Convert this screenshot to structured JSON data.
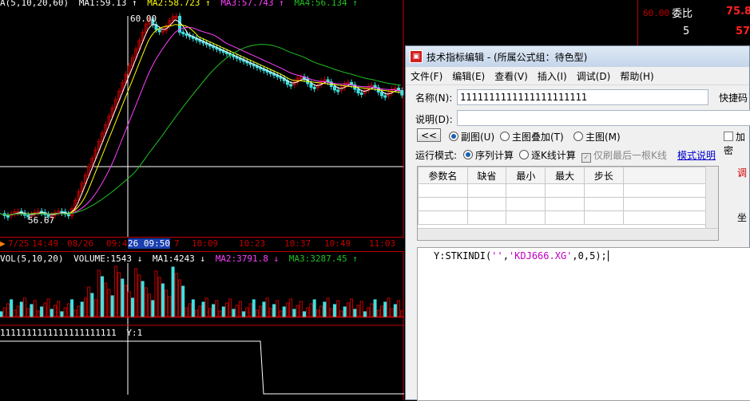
{
  "colors": {
    "up": "#c00000",
    "down": "#40e0e0",
    "ma1": "#ffffff",
    "ma2": "#ffff00",
    "ma3": "#ff40ff",
    "ma4": "#20c020",
    "axis": "#c00000"
  },
  "price_panel": {
    "legend": [
      "A(5,10,20,60)",
      "MA1:59.13 ↑",
      "MA2:58.723 ↑",
      "MA3:57.743 ↑",
      "MA4:56.134 ↑"
    ],
    "high_label": "60.00",
    "low_label": "56.67"
  },
  "time_axis": {
    "labels": [
      "7/25",
      "14:49",
      "08/26",
      "09:4",
      "26 09:50",
      "7",
      "10:09",
      "10:23",
      "10:37",
      "10:49",
      "11:03"
    ]
  },
  "volume_panel": {
    "legend": [
      "VOL(5,10,20)",
      "VOLUME:1543 ↓",
      "MA1:4243 ↓",
      "MA2:3791.8 ↓",
      "MA3:3287.45 ↑"
    ]
  },
  "indicator_panel": {
    "legend": [
      "1111111111111111111111",
      "Y:1"
    ]
  },
  "right_panel": {
    "price_label": "60.00",
    "weibi_label": "委比",
    "weibi_value": "75.8",
    "row_num": "5",
    "row_val": "57"
  },
  "dialog": {
    "title": "技术指标编辑 - (所属公式组：待色型)",
    "menu": [
      "文件(F)",
      "编辑(E)",
      "查看(V)",
      "插入(I)",
      "调试(D)",
      "帮助(H)"
    ],
    "name_label": "名称(N):",
    "name_value": "1111111111111111111111",
    "shortcut_label": "快捷码",
    "desc_label": "说明(D):",
    "desc_value": "",
    "back_button": "<<",
    "radio_sub": "副图(U)",
    "radio_overlay": "主图叠加(T)",
    "radio_main": "主图(M)",
    "chk_add": "加密",
    "run_mode_label": "运行模式:",
    "radio_seq": "序列计算",
    "radio_line": "逐K线计算",
    "chk_refresh": "仅刷最后一根K线",
    "mode_link": "模式说明",
    "param_headers": [
      "参数名",
      "缺省",
      "最小",
      "最大",
      "步长"
    ],
    "side_label_1": "调",
    "side_label_2": "坐",
    "code": "Y:STKINDI('','KDJ666.XG',0,5);"
  }
}
